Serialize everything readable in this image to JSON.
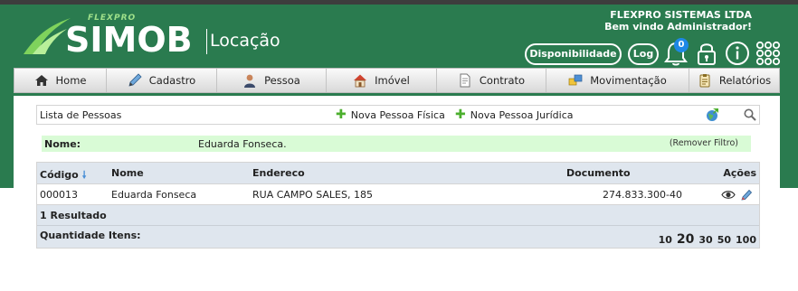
{
  "brand": {
    "company_tag": "FLEXPRO",
    "product": "SIMOB",
    "module": "Locação"
  },
  "header": {
    "company_name": "FLEXPRO SISTEMAS LTDA",
    "welcome": "Bem vindo Administrador!",
    "availability_button": "Disponibilidade",
    "log_button": "Log",
    "notification_count": "0"
  },
  "nav": {
    "items": [
      {
        "label": "Home",
        "icon": "home-icon"
      },
      {
        "label": "Cadastro",
        "icon": "pencil-icon"
      },
      {
        "label": "Pessoa",
        "icon": "person-icon"
      },
      {
        "label": "Imóvel",
        "icon": "house-icon"
      },
      {
        "label": "Contrato",
        "icon": "document-icon"
      },
      {
        "label": "Movimentação",
        "icon": "transfer-icon"
      },
      {
        "label": "Relatórios",
        "icon": "clipboard-icon"
      }
    ]
  },
  "toolbar": {
    "title": "Lista de Pessoas",
    "new_individual": "Nova Pessoa Física",
    "new_company": "Nova Pessoa Jurídica"
  },
  "filter": {
    "label": "Nome:",
    "value": "Eduarda Fonseca.",
    "remove": "(Remover Filtro)"
  },
  "table": {
    "columns": {
      "code": "Código",
      "name": "Nome",
      "address": "Endereco",
      "document": "Documento",
      "actions": "Ações"
    },
    "rows": [
      {
        "code": "000013",
        "name": "Eduarda Fonseca",
        "address": "RUA CAMPO SALES, 185",
        "document": "274.833.300-40"
      }
    ],
    "result_count": "1 Resultado",
    "quantity_label": "Quantidade Itens:",
    "page_sizes": [
      "10",
      "20",
      "30",
      "50",
      "100"
    ],
    "selected_page_size": "20"
  },
  "colors": {
    "header_green": "#2a7b4f",
    "filter_bg": "#d9fbd6",
    "table_head_bg": "#dfe6ee",
    "badge_blue": "#1e88e5"
  }
}
